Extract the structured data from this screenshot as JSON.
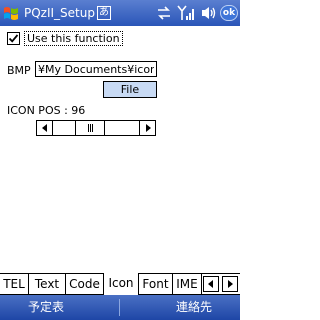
{
  "titlebar": {
    "app_title": "PQzII_Setup",
    "ime_indicator": "あ",
    "ok_label": "ok",
    "icons": [
      "windows-start-icon",
      "data-connection-icon",
      "signal-strength-icon",
      "volume-icon"
    ]
  },
  "options": {
    "use_function_label": "Use this function",
    "use_function_checked": true
  },
  "bmp": {
    "label": "BMP",
    "path_value": "¥My Documents¥icons¥y",
    "file_button_label": "File"
  },
  "icon_pos": {
    "label": "ICON POS : 96",
    "value": 96
  },
  "tabs": [
    {
      "label": "TEL",
      "active": false
    },
    {
      "label": "Text",
      "active": false
    },
    {
      "label": "Code",
      "active": false
    },
    {
      "label": "Icon",
      "active": true
    },
    {
      "label": "Font",
      "active": false
    },
    {
      "label": "IME",
      "active": false
    }
  ],
  "softkeys": {
    "left": "予定表",
    "right": "連絡先"
  }
}
